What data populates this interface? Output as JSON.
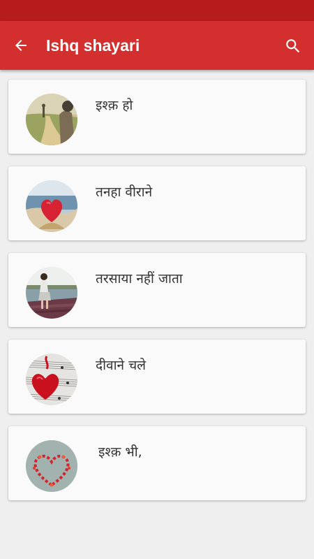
{
  "app_bar": {
    "title": "Ishq shayari",
    "back_icon": "arrow-back-icon",
    "search_icon": "search-icon",
    "color": "#d32f2f",
    "status_bar_color": "#b71c1c"
  },
  "items": [
    {
      "title": "इश्क़ हो",
      "image": "couple-on-path-image"
    },
    {
      "title": "तनहा वीराने",
      "image": "red-heart-on-beach-image"
    },
    {
      "title": "तरसाया नहीं जाता",
      "image": "girl-on-pier-image"
    },
    {
      "title": "दीवाने चले",
      "image": "heart-on-sheet-music-image"
    },
    {
      "title": "इश्क़ भी,",
      "image": "rose-petal-heart-image"
    }
  ]
}
